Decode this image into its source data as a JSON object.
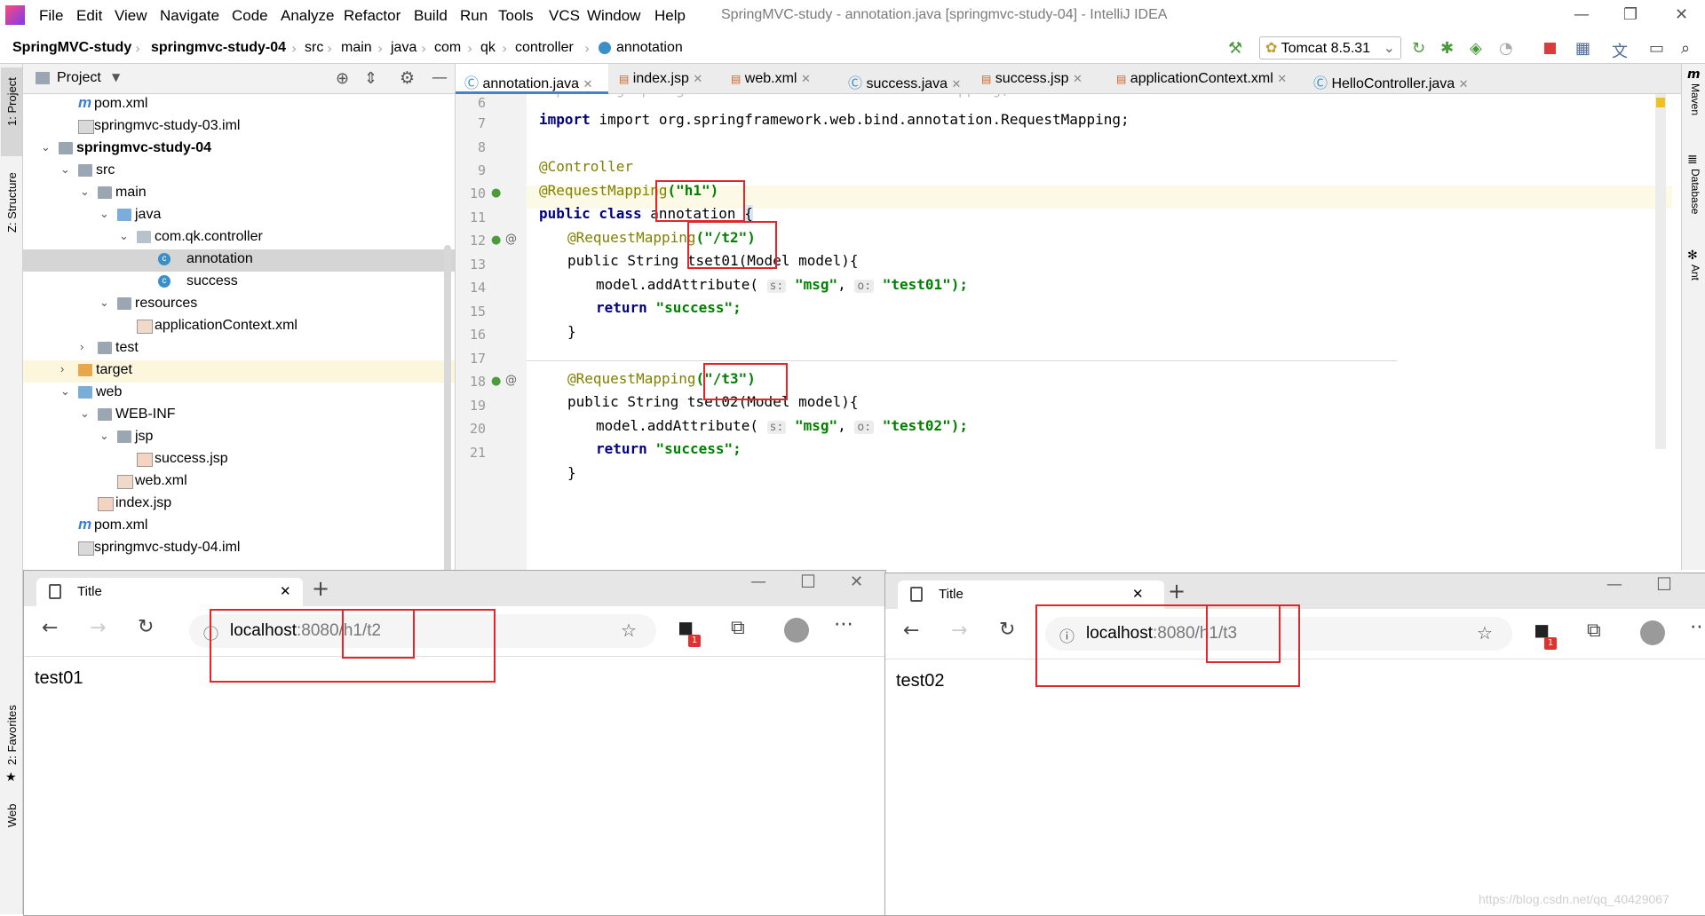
{
  "titlebar": {
    "menu": [
      "File",
      "Edit",
      "View",
      "Navigate",
      "Code",
      "Analyze",
      "Refactor",
      "Build",
      "Run",
      "Tools",
      "VCS",
      "Window",
      "Help"
    ],
    "window_title": "SpringMVC-study - annotation.java [springmvc-study-04] - IntelliJ IDEA"
  },
  "breadcrumbs": [
    "SpringMVC-study",
    "springmvc-study-04",
    "src",
    "main",
    "java",
    "com",
    "qk",
    "controller",
    "annotation"
  ],
  "run_config": "Tomcat 8.5.31",
  "left_strip": {
    "project": "1: Project",
    "structure": "Z: Structure",
    "favorites": "2: Favorites",
    "web": "Web"
  },
  "right_strip": {
    "maven": "Maven",
    "database": "Database",
    "ant": "Ant"
  },
  "project_panel": {
    "title": "Project",
    "tree": [
      {
        "label": "pom.xml",
        "icon": "maven-icon"
      },
      {
        "label": "springmvc-study-03.iml",
        "icon": "iml-file-icon"
      },
      {
        "label": "springmvc-study-04",
        "icon": "module-folder-icon"
      },
      {
        "label": "src",
        "icon": "folder-icon"
      },
      {
        "label": "main",
        "icon": "folder-icon"
      },
      {
        "label": "java",
        "icon": "source-folder-icon"
      },
      {
        "label": "com.qk.controller",
        "icon": "package-icon"
      },
      {
        "label": "annotation",
        "icon": "class-icon"
      },
      {
        "label": "success",
        "icon": "class-icon"
      },
      {
        "label": "resources",
        "icon": "resources-folder-icon"
      },
      {
        "label": "applicationContext.xml",
        "icon": "xml-file-icon"
      },
      {
        "label": "test",
        "icon": "folder-icon"
      },
      {
        "label": "target",
        "icon": "excluded-folder-icon"
      },
      {
        "label": "web",
        "icon": "web-folder-icon"
      },
      {
        "label": "WEB-INF",
        "icon": "folder-icon"
      },
      {
        "label": "jsp",
        "icon": "folder-icon"
      },
      {
        "label": "success.jsp",
        "icon": "jsp-file-icon"
      },
      {
        "label": "web.xml",
        "icon": "xml-file-icon"
      },
      {
        "label": "index.jsp",
        "icon": "jsp-file-icon"
      },
      {
        "label": "pom.xml",
        "icon": "maven-icon"
      },
      {
        "label": "springmvc-study-04.iml",
        "icon": "iml-file-icon"
      }
    ]
  },
  "tabs": [
    "annotation.java",
    "index.jsp",
    "web.xml",
    "success.java",
    "success.jsp",
    "applicationContext.xml",
    "HelloController.java"
  ],
  "code": {
    "line_numbers": [
      "6",
      "7",
      "8",
      "9",
      "10",
      "11",
      "12",
      "13",
      "14",
      "15",
      "16",
      "17",
      "18",
      "19",
      "20",
      "21"
    ],
    "import_line": "import org.springframework.web.bind.annotation.RequestMapping;",
    "controller": "@Controller",
    "rm_prefix": "@RequestMapping",
    "h1": "(\"h1\")",
    "class_decl_kw": "public class",
    "class_name": " annotation ",
    "brace": "{",
    "t2": "(\"/t2\")",
    "method1": "public String tset01(Model model){",
    "add_attr": "model.addAttribute(",
    "hint_s": "s:",
    "hint_o": "o:",
    "msg": "\"msg\"",
    "test01": "\"test01\");",
    "return_kw": "return",
    "success": "\"success\";",
    "close": "}",
    "t3": "(\"/t3\")",
    "method2": "public String tset02(Model model){",
    "test02": "\"test02\");"
  },
  "browser1": {
    "tab_title": "Title",
    "url_host": "localhost",
    "url_rest": ":8080/h1/t2",
    "content": "test01",
    "badge": "1"
  },
  "browser2": {
    "tab_title": "Title",
    "url_host": "localhost",
    "url_rest": ":8080/h1/t3",
    "content": "test02",
    "badge": "1"
  },
  "watermark": "https://blog.csdn.net/qq_40429067"
}
